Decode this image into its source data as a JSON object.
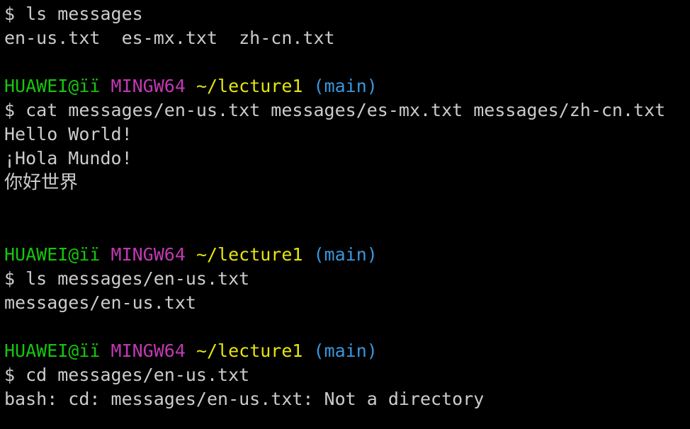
{
  "terminal": {
    "theme": {
      "background": "#000000",
      "text": "#cccccc",
      "user": "#16c60c",
      "system": "#c239b3",
      "path": "#e5e510",
      "branch": "#3a96dd"
    },
    "blocks": [
      {
        "command": "$ ls messages",
        "output": [
          "en-us.txt  es-mx.txt  zh-cn.txt"
        ]
      },
      {
        "prompt": {
          "user": "HUAWEI@ïï",
          "system": "MINGW64",
          "path": "~/lecture1",
          "branch": "(main)"
        },
        "command": "$ cat messages/en-us.txt messages/es-mx.txt messages/zh-cn.txt",
        "output": [
          "Hello World!",
          "¡Hola Mundo!",
          "你好世界"
        ]
      },
      {
        "prompt": {
          "user": "HUAWEI@ïï",
          "system": "MINGW64",
          "path": "~/lecture1",
          "branch": "(main)"
        },
        "command": "$ ls messages/en-us.txt",
        "output": [
          "messages/en-us.txt"
        ]
      },
      {
        "prompt": {
          "user": "HUAWEI@ïï",
          "system": "MINGW64",
          "path": "~/lecture1",
          "branch": "(main)"
        },
        "command": "$ cd messages/en-us.txt",
        "output": [
          "bash: cd: messages/en-us.txt: Not a directory"
        ]
      }
    ]
  }
}
